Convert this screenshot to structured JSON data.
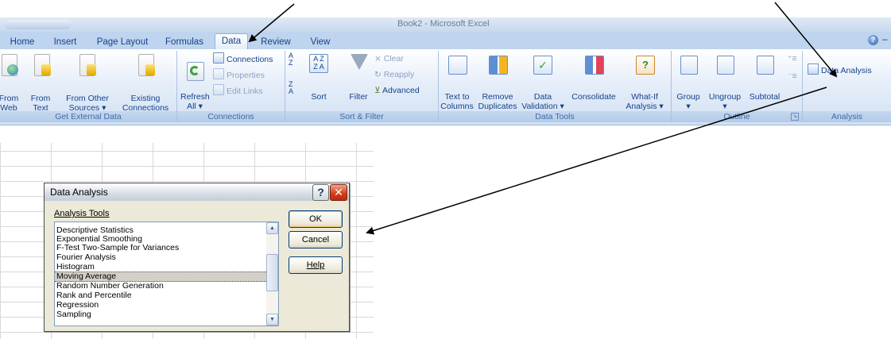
{
  "window": {
    "title": "Book2 - Microsoft Excel"
  },
  "tabs": [
    {
      "label": "Home"
    },
    {
      "label": "Insert"
    },
    {
      "label": "Page Layout"
    },
    {
      "label": "Formulas"
    },
    {
      "label": "Data",
      "active": true
    },
    {
      "label": "Review"
    },
    {
      "label": "View"
    }
  ],
  "ribbon": {
    "groups": {
      "get_external_data": {
        "label": "Get External Data",
        "buttons": [
          {
            "line1": "From",
            "line2": "Web"
          },
          {
            "line1": "From",
            "line2": "Text"
          },
          {
            "line1": "From Other",
            "line2": "Sources ▾"
          },
          {
            "line1": "Existing",
            "line2": "Connections"
          }
        ]
      },
      "connections": {
        "label": "Connections",
        "refresh": {
          "line1": "Refresh",
          "line2": "All ▾"
        },
        "small": [
          "Connections",
          "Properties",
          "Edit Links"
        ]
      },
      "sort_filter": {
        "label": "Sort & Filter",
        "sort": "Sort",
        "filter": "Filter",
        "small": [
          "Clear",
          "Reapply",
          "Advanced"
        ]
      },
      "data_tools": {
        "label": "Data Tools",
        "buttons": [
          {
            "line1": "Text to",
            "line2": "Columns"
          },
          {
            "line1": "Remove",
            "line2": "Duplicates"
          },
          {
            "line1": "Data",
            "line2": "Validation ▾"
          },
          {
            "line1": "Consolidate",
            "line2": ""
          },
          {
            "line1": "What-If",
            "line2": "Analysis ▾"
          }
        ]
      },
      "outline": {
        "label": "Outline",
        "buttons": [
          "Group",
          "Ungroup",
          "Subtotal"
        ]
      },
      "analysis": {
        "label": "Analysis",
        "data_analysis": "Data Analysis"
      }
    }
  },
  "dialog": {
    "title": "Data Analysis",
    "help_glyph": "?",
    "close_glyph": "✕",
    "list_label": "Analysis Tools",
    "items": [
      "Descriptive Statistics",
      "Exponential Smoothing",
      "F-Test Two-Sample for Variances",
      "Fourier Analysis",
      "Histogram",
      "Moving Average",
      "Random Number Generation",
      "Rank and Percentile",
      "Regression",
      "Sampling"
    ],
    "selected_item": "Moving Average",
    "buttons": {
      "ok": "OK",
      "cancel": "Cancel",
      "help": "Help"
    }
  }
}
